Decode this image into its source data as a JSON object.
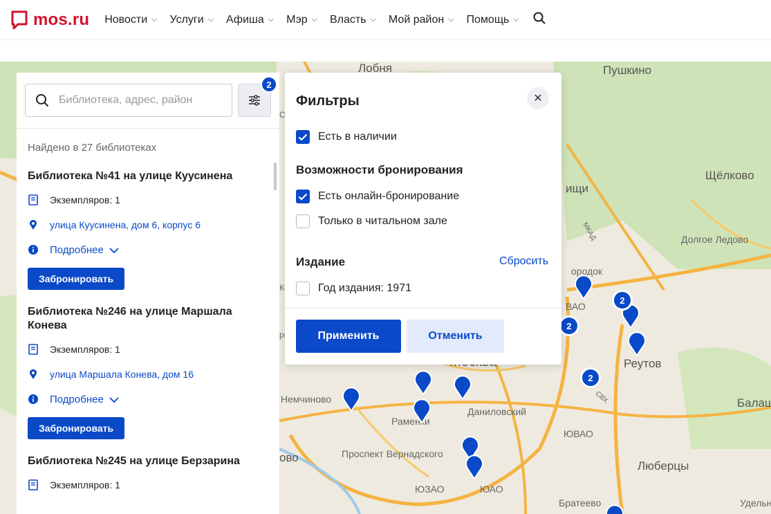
{
  "header": {
    "logo_text": "mos.ru",
    "nav": [
      "Новости",
      "Услуги",
      "Афиша",
      "Мэр",
      "Власть",
      "Мой район",
      "Помощь"
    ]
  },
  "search": {
    "placeholder": "Библиотека, адрес, район",
    "filter_count": "2"
  },
  "results": {
    "found_text": "Найдено в 27 библиотеках",
    "libraries": [
      {
        "title": "Библиотека №41 на улице Куусинена",
        "copies": "Экземпляров: 1",
        "address": "улица Куусинена, дом 6, корпус 6",
        "more": "Подробнее",
        "book": "Забронировать"
      },
      {
        "title": "Библиотека №246 на улице Маршала Конева",
        "copies": "Экземпляров: 1",
        "address": "улица Маршала Конева, дом 16",
        "more": "Подробнее",
        "book": "Забронировать"
      },
      {
        "title": "Библиотека №245 на улице Берзарина",
        "copies": "Экземпляров: 1"
      }
    ]
  },
  "filters": {
    "title": "Фильтры",
    "in_stock": {
      "label": "Есть в наличии",
      "checked": true
    },
    "booking_heading": "Возможности бронирования",
    "online_booking": {
      "label": "Есть онлайн-бронирование",
      "checked": true
    },
    "reading_room": {
      "label": "Только в читальном зале",
      "checked": false
    },
    "edition_heading": "Издание",
    "reset": "Сбросить",
    "year": {
      "label": "Год издания: 1971",
      "checked": false
    },
    "apply": "Применить",
    "cancel": "Отменить"
  },
  "map": {
    "labels": [
      "Лобня",
      "Пушкино",
      "Щёлково",
      "Долгое Ледово",
      "Реутов",
      "Балаши",
      "Москва",
      "Немчиново",
      "Раменки",
      "Даниловский",
      "ЮВАО",
      "Проспект Вернадского",
      "Люберцы",
      "ЮЗАО",
      "ЮАО",
      "Братеево",
      "Удельн",
      "ищи",
      "ородок",
      "ВАО",
      "МКАД",
      "СВХ",
      "Слю",
      "Коо",
      "ово",
      "рв"
    ],
    "clusters": [
      "2",
      "2",
      "2"
    ],
    "colors": {
      "accent": "#0a49c8",
      "brand": "#d1112c"
    }
  }
}
